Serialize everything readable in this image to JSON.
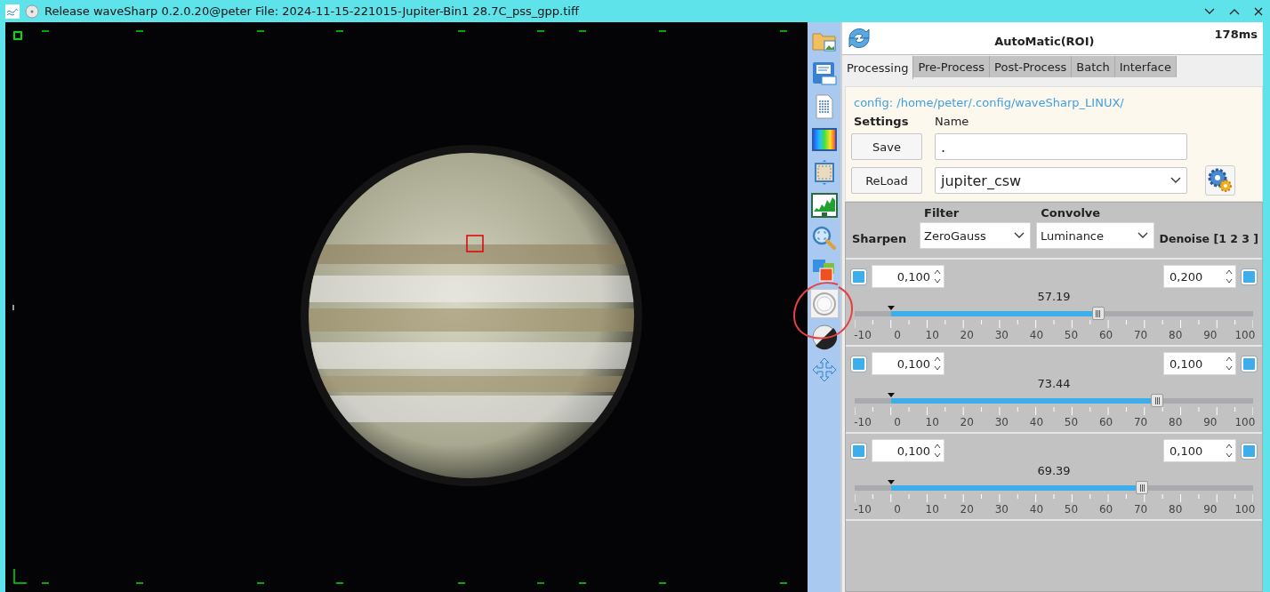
{
  "window": {
    "title": "Release waveSharp 0.2.0.20@peter File: 2024-11-15-221015-Jupiter-Bin1 28.7C_pss_gpp.tiff"
  },
  "toolbar": [
    {
      "kind": "open-image",
      "selected": false
    },
    {
      "kind": "save",
      "selected": false
    },
    {
      "kind": "log",
      "selected": false
    },
    {
      "kind": "color",
      "selected": false
    },
    {
      "kind": "crop",
      "selected": false
    },
    {
      "kind": "histogram",
      "selected": false
    },
    {
      "kind": "zoom",
      "selected": false
    },
    {
      "kind": "layers",
      "selected": false
    },
    {
      "kind": "circle",
      "selected": true
    },
    {
      "kind": "contrast",
      "selected": false
    },
    {
      "kind": "move",
      "selected": false
    }
  ],
  "header": {
    "mode": "AutoMatic(ROI)",
    "timing": "178ms"
  },
  "tabs": [
    {
      "label": "Processing",
      "selected": true
    },
    {
      "label": "Pre-Process",
      "selected": false
    },
    {
      "label": "Post-Process",
      "selected": false
    },
    {
      "label": "Batch",
      "selected": false
    },
    {
      "label": "Interface",
      "selected": false
    }
  ],
  "settings": {
    "config_path": "config: /home/peter/.config/waveSharp_LINUX/",
    "heading": "Settings",
    "name_label": "Name",
    "save_button": "Save",
    "name_value": ".",
    "reload_button": "ReLoad",
    "preset": "jupiter_csw"
  },
  "sharpen": {
    "label": "Sharpen",
    "filter_label": "Filter",
    "filter": "ZeroGauss",
    "convolve_label": "Convolve",
    "convolve": "Luminance",
    "denoise_label": "Denoise [1 2 3 ]"
  },
  "sliders": [
    {
      "left_checked": true,
      "left_value": "0,100",
      "right_value": "0,200",
      "right_checked": true,
      "reading": "57.19",
      "level": 0.611,
      "ticks": [
        "-10",
        "0",
        "10",
        "20",
        "30",
        "40",
        "50",
        "60",
        "70",
        "80",
        "90",
        "100"
      ]
    },
    {
      "left_checked": true,
      "left_value": "0,100",
      "right_value": "0,100",
      "right_checked": true,
      "reading": "73.44",
      "level": 0.759,
      "ticks": [
        "-10",
        "0",
        "10",
        "20",
        "30",
        "40",
        "50",
        "60",
        "70",
        "80",
        "90",
        "100"
      ]
    },
    {
      "left_checked": true,
      "left_value": "0,100",
      "right_value": "0,100",
      "right_checked": true,
      "reading": "69.39",
      "level": 0.722,
      "ticks": [
        "-10",
        "0",
        "10",
        "20",
        "30",
        "40",
        "50",
        "60",
        "70",
        "80",
        "90",
        "100"
      ]
    }
  ]
}
